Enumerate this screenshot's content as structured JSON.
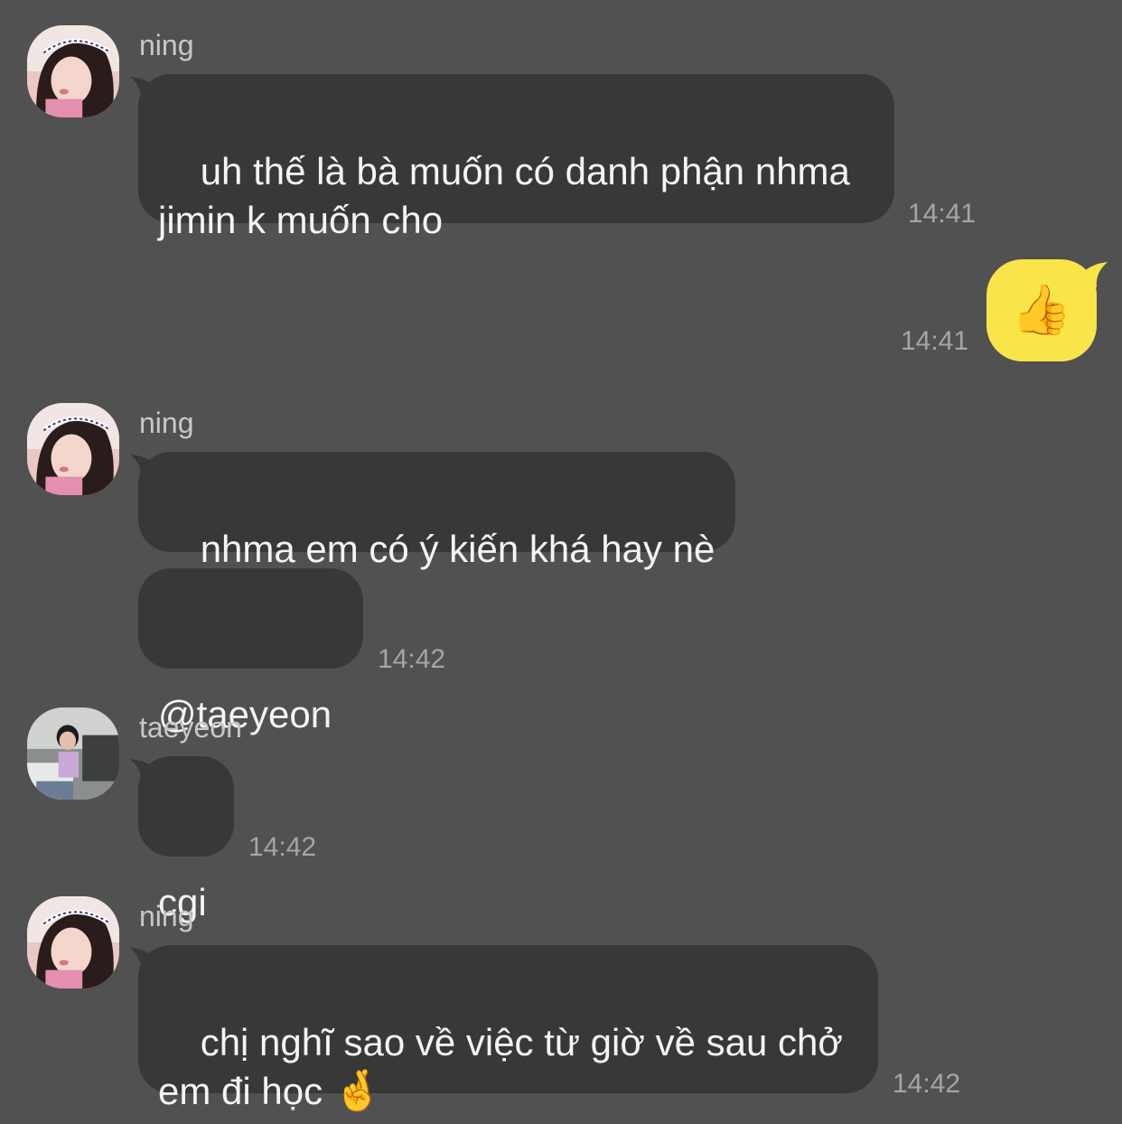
{
  "colors": {
    "background": "#525152",
    "incoming_bubble": "#383839",
    "outgoing_bubble": "#f9e54a",
    "sender_text": "#c9c8c9",
    "time_text": "#a6a5a6"
  },
  "messages": [
    {
      "sender": "ning",
      "avatar_icon": "avatar-ning-photo",
      "text": "uh thế là bà muốn có danh phận nhma\njimin k muốn cho",
      "time": "14:41"
    },
    {
      "outgoing": true,
      "emoji": "👍",
      "emoji_icon": "thumbs-up-icon",
      "time": "14:41"
    },
    {
      "sender": "ning",
      "avatar_icon": "avatar-ning-photo",
      "text": "nhma em có ý kiến khá hay nè"
    },
    {
      "sender": "ning",
      "text": "@taeyeon",
      "time": "14:42"
    },
    {
      "sender": "taeyeon",
      "avatar_icon": "avatar-taeyeon-photo",
      "text": "cgi",
      "time": "14:42"
    },
    {
      "sender": "ning",
      "avatar_icon": "avatar-ning-photo",
      "text": "chị nghĩ sao về việc từ giờ về sau chở\nem đi học ",
      "emoji": "🤞",
      "emoji_icon": "crossed-fingers-icon",
      "time": "14:42"
    }
  ]
}
